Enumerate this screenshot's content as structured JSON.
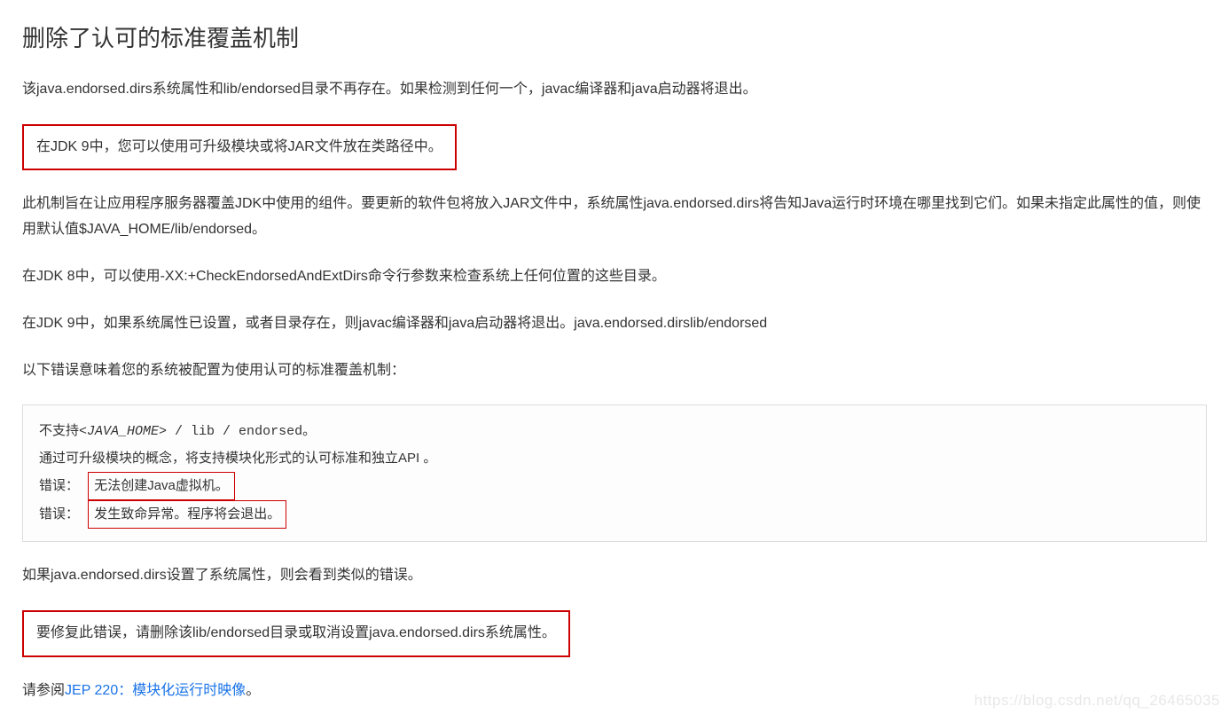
{
  "heading": "删除了认可的标准覆盖机制",
  "para1": "该java.endorsed.dirs系统属性和lib/endorsed目录不再存在。如果检测到任何一个，javac编译器和java启动器将退出。",
  "box1": "在JDK 9中，您可以使用可升级模块或将JAR文件放在类路径中。",
  "para2": "此机制旨在让应用程序服务器覆盖JDK中使用的组件。要更新的软件包将放入JAR文件中，系统属性java.endorsed.dirs将告知Java运行时环境在哪里找到它们。如果未指定此属性的值，则使用默认值$JAVA_HOME/lib/endorsed。",
  "para3": "在JDK 8中，可以使用-XX:+CheckEndorsedAndExtDirs命令行参数来检查系统上任何位置的这些目录。",
  "para4": "在JDK 9中，如果系统属性已设置，或者目录存在，则javac编译器和java启动器将退出。java.endorsed.dirslib/endorsed",
  "para5": "以下错误意味着您的系统被配置为使用认可的标准覆盖机制：",
  "codeblock": {
    "line1_prefix": "不支持",
    "line1_italic": "<JAVA_HOME>",
    "line1_suffix": " / lib / endorsed。",
    "line2": "通过可升级模块的概念，将支持模块化形式的认可标准和独立API 。",
    "error_label": "错误：",
    "error1": "无法创建Java虚拟机。",
    "error2": "发生致命异常。程序将会退出。"
  },
  "para6": "如果java.endorsed.dirs设置了系统属性，则会看到类似的错误。",
  "box2": "要修复此错误，请删除该lib/endorsed目录或取消设置java.endorsed.dirs系统属性。",
  "para7_prefix": "请参阅",
  "para7_link": "JEP 220：模块化运行时映像",
  "para7_suffix": "。",
  "watermark": "https://blog.csdn.net/qq_26465035"
}
